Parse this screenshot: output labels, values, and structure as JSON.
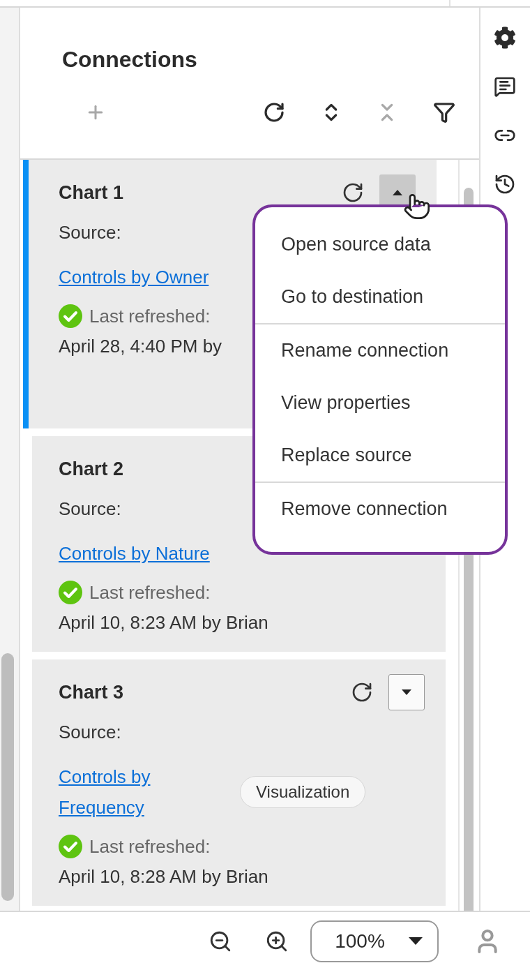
{
  "panel": {
    "title": "Connections"
  },
  "toolbar": [
    {
      "kind": "add",
      "disabled": true
    },
    {
      "kind": "refresh",
      "disabled": false
    },
    {
      "kind": "expand",
      "disabled": false
    },
    {
      "kind": "collapse",
      "disabled": true
    },
    {
      "kind": "filter",
      "disabled": false
    }
  ],
  "connections": [
    {
      "title": "Chart 1",
      "source_label": "Source:",
      "link": "Controls by Owner",
      "status": "Last refreshed:",
      "refreshed": "April 28, 4:40 PM by",
      "selected": true,
      "dropdown": {
        "expanded": true
      }
    },
    {
      "title": "Chart 2",
      "source_label": "Source:",
      "link": "Controls by Nature",
      "status": "Last refreshed:",
      "refreshed": "April 10, 8:23 AM by Brian",
      "selected": false
    },
    {
      "title": "Chart 3",
      "source_label": "Source:",
      "link": "Controls by Frequency",
      "badge": "Visualization",
      "status": "Last refreshed:",
      "refreshed": "April 10, 8:28 AM by Brian",
      "selected": false,
      "dropdown": {
        "expanded": false
      }
    }
  ],
  "menu": {
    "sections": [
      [
        "Open source data",
        "Go to destination"
      ],
      [
        "Rename connection",
        "View properties",
        "Replace source"
      ],
      [
        "Remove connection"
      ]
    ]
  },
  "rail": [
    {
      "kind": "settings"
    },
    {
      "kind": "comments"
    },
    {
      "kind": "link"
    },
    {
      "kind": "history"
    }
  ],
  "zoom": {
    "value": "100%"
  }
}
